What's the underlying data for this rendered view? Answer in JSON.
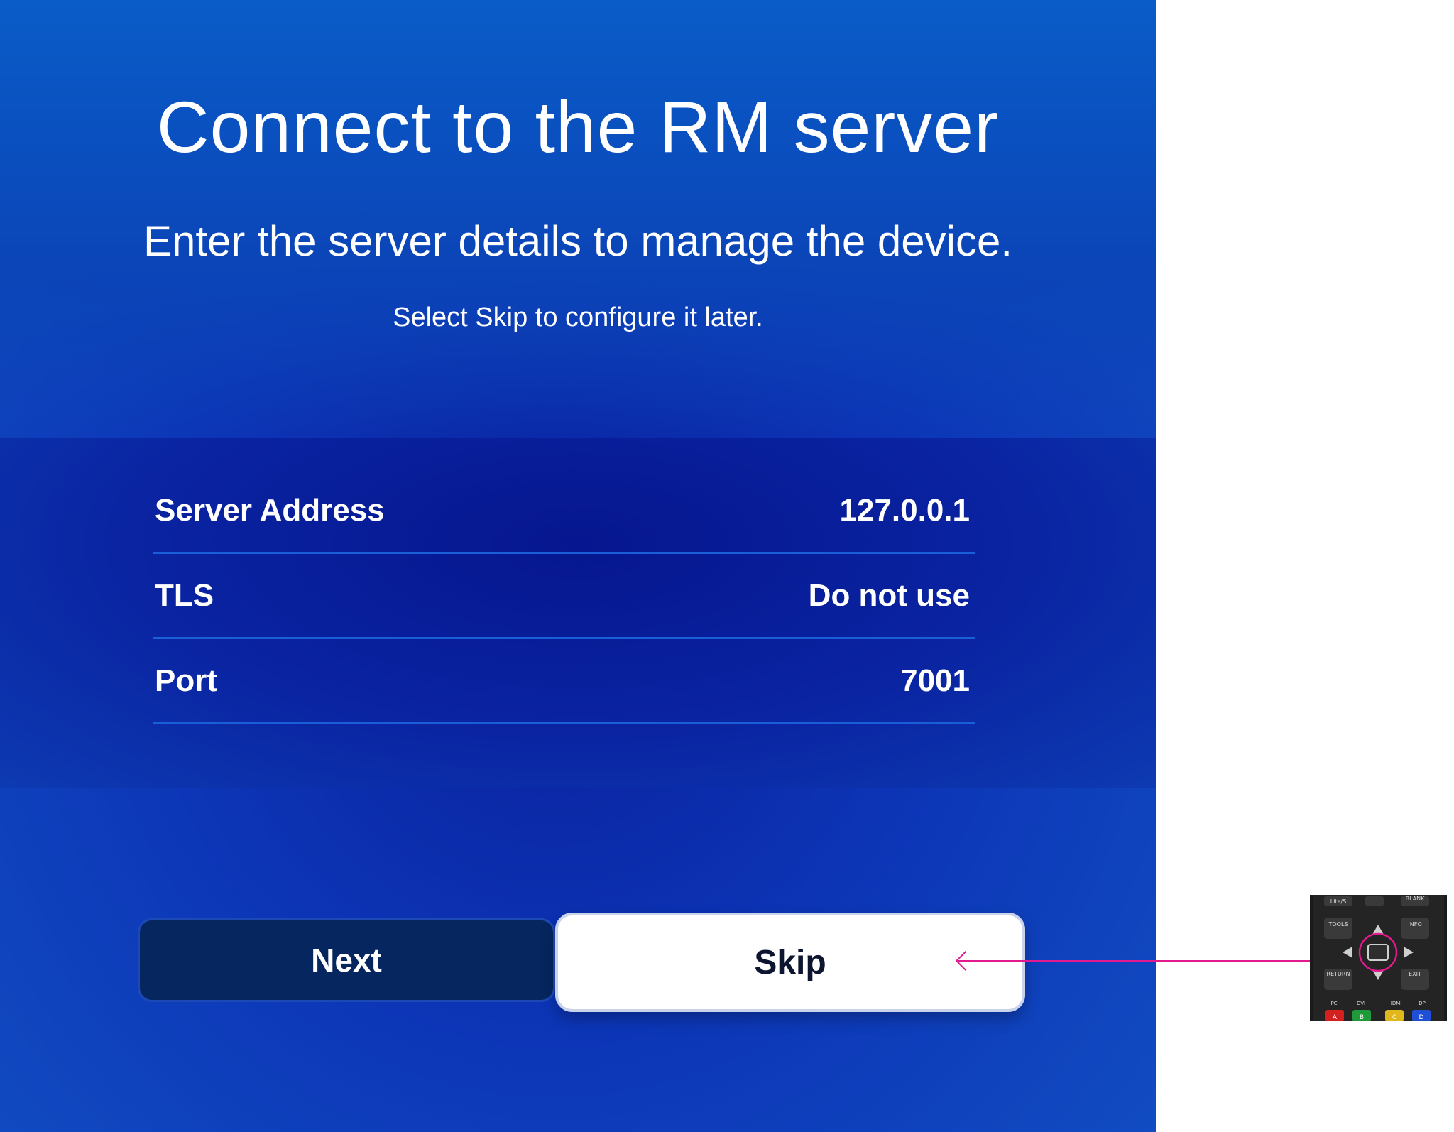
{
  "header": {
    "title": "Connect to the RM server",
    "subtitle": "Enter the server details to manage the device.",
    "hint": "Select Skip to configure it later."
  },
  "settings": [
    {
      "label": "Server Address",
      "value": "127.0.0.1"
    },
    {
      "label": "TLS",
      "value": "Do not use"
    },
    {
      "label": "Port",
      "value": "7001"
    }
  ],
  "buttons": {
    "next_label": "Next",
    "skip_label": "Skip"
  },
  "remote": {
    "keys": {
      "top_left": "Lite/S",
      "top_right": "BLANK",
      "tools": "TOOLS",
      "info": "INFO",
      "return": "RETURN",
      "exit": "EXIT",
      "pc": "PC",
      "dvi": "DVI",
      "hdmi": "HDMI",
      "dp": "DP",
      "a": "A",
      "b": "B",
      "c": "C",
      "d": "D"
    },
    "highlight_color": "#e3198f"
  },
  "colors": {
    "accent": "#e3198f",
    "background": "#0c35b6",
    "next_bg": "#06265f",
    "skip_bg": "#ffffff"
  }
}
